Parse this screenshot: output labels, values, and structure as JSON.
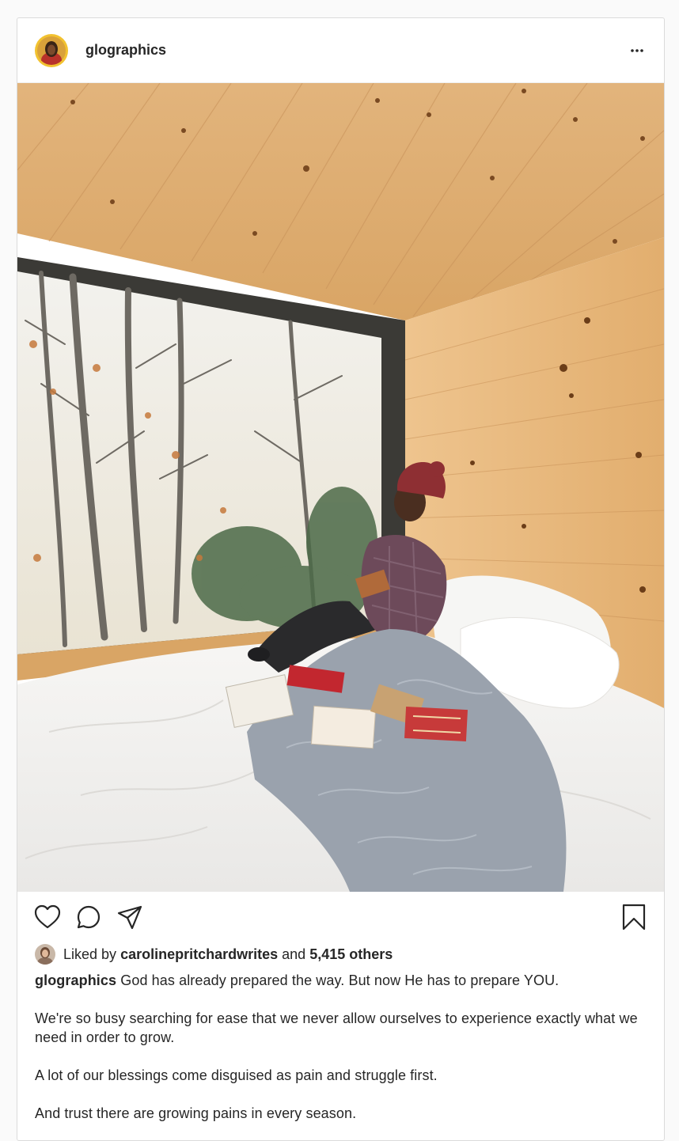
{
  "post": {
    "username": "glographics",
    "more_label": "More options",
    "liked_by_prefix": "Liked by",
    "liked_by_user": "carolinepritchardwrites",
    "and_text": "and",
    "others_count": "5,415 others",
    "caption_user": "glographics",
    "caption_first": "God has already prepared the way. But now He has to prepare YOU.",
    "caption_paragraphs": [
      "We're so busy searching for ease that we never allow ourselves to experience exactly what we need in order to grow.",
      "A lot of our blessings come disguised as pain and struggle first.",
      "And trust there are growing pains in every season."
    ]
  },
  "icons": {
    "like": "heart-icon",
    "comment": "comment-icon",
    "share": "paper-plane-icon",
    "save": "bookmark-icon",
    "more": "ellipsis-icon"
  },
  "colors": {
    "text": "#262626",
    "border": "#dbdbdb",
    "avatar_ring": "#f2c230"
  }
}
